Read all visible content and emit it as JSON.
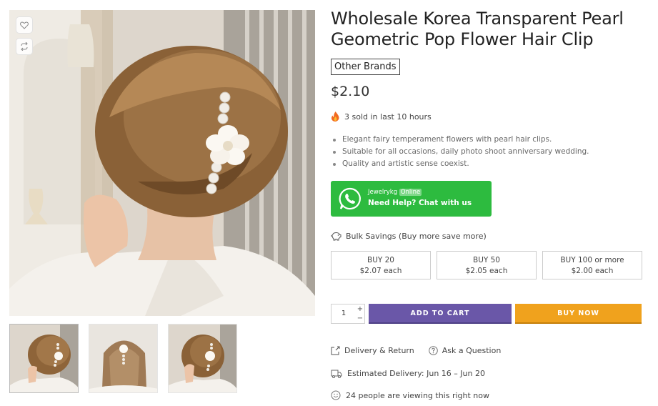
{
  "product": {
    "title": "Wholesale Korea Transparent Pearl Geometric Pop Flower Hair Clip",
    "brand": "Other Brands",
    "price": "$2.10",
    "sold_text": "3 sold in last 10 hours",
    "features": [
      "Elegant fairy temperament flowers with pearl hair clips.",
      "Suitable for all occasions, daily photo shoot anniversary wedding.",
      "Quality and artistic sense coexist."
    ]
  },
  "whatsapp": {
    "name": "Jewelrykg",
    "status": "Online",
    "cta": "Need Help? Chat with us"
  },
  "bulk": {
    "title": "Bulk Savings (Buy more save more)",
    "tiers": [
      {
        "qty": "BUY 20",
        "price": "$2.07 each"
      },
      {
        "qty": "BUY 50",
        "price": "$2.05 each"
      },
      {
        "qty": "BUY 100 or more",
        "price": "$2.00 each"
      }
    ]
  },
  "cart": {
    "quantity": "1",
    "plus": "+",
    "minus": "−",
    "add_to_cart": "ADD TO CART",
    "buy_now": "BUY NOW"
  },
  "links": {
    "delivery": "Delivery & Return",
    "question": "Ask a Question"
  },
  "delivery_estimate": "Estimated Delivery: Jun 16 – Jun 20",
  "viewers": "24 people are viewing this right now",
  "icons": {
    "wishlist": "heart-icon",
    "compare": "refresh-icon",
    "fire": "fire-icon",
    "whatsapp": "whatsapp-icon",
    "bulk": "piggy-bank-icon",
    "delivery": "external-link-icon",
    "question": "question-circle-icon",
    "truck": "truck-icon",
    "smile": "smile-icon"
  },
  "colors": {
    "whatsapp_green": "#2dbb3f",
    "add_to_cart": "#6a57a8",
    "buy_now": "#f0a21d"
  }
}
